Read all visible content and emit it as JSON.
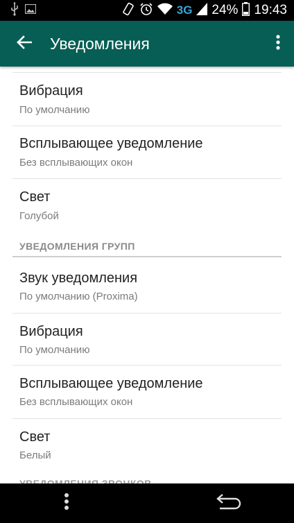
{
  "status_bar": {
    "network": "3G",
    "battery": "24%",
    "time": "19:43"
  },
  "app_bar": {
    "title": "Уведомления",
    "back_icon": "arrow-back-icon",
    "more_icon": "more-vert-icon"
  },
  "settings": {
    "messages": [
      {
        "title": "Вибрация",
        "value": "По умолчанию"
      },
      {
        "title": "Всплывающее уведомление",
        "value": "Без всплывающих окон"
      },
      {
        "title": "Свет",
        "value": "Голубой"
      }
    ],
    "group_header": "УВЕДОМЛЕНИЯ ГРУПП",
    "groups": [
      {
        "title": "Звук уведомления",
        "value": "По умолчанию (Proxima)"
      },
      {
        "title": "Вибрация",
        "value": "По умолчанию"
      },
      {
        "title": "Всплывающее уведомление",
        "value": "Без всплывающих окон"
      },
      {
        "title": "Свет",
        "value": "Белый"
      }
    ],
    "calls_header_partial": "УВЕДОМЛЕНИЯ ЗВОНКОВ"
  },
  "nav_bar": {
    "menu_icon": "menu-dots-icon",
    "back_icon": "nav-back-icon"
  },
  "colors": {
    "app_bar": "#075e54",
    "status_bar": "#000000",
    "network": "#3aa4d6"
  }
}
